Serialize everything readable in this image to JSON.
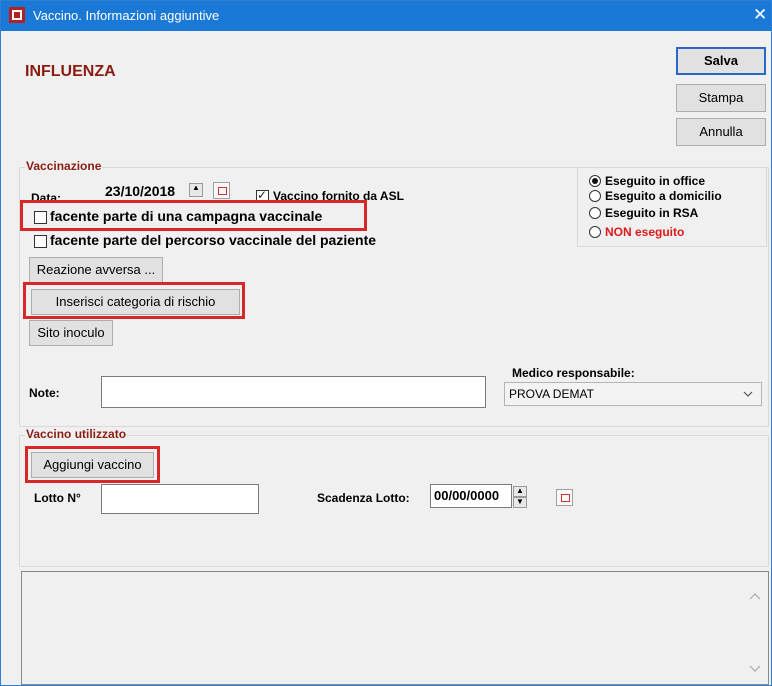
{
  "window": {
    "title": "Vaccino. Informazioni aggiuntive",
    "close_symbol": "✕"
  },
  "header": {
    "title": "INFLUENZA"
  },
  "buttons": {
    "save": "Salva",
    "print": "Stampa",
    "cancel": "Annulla"
  },
  "vaccination": {
    "group_label": "Vaccinazione",
    "date_label": "Data:",
    "date_value": "23/10/2018",
    "asl_checkbox_label": "Vaccino fornito da ASL",
    "asl_checked": true,
    "campaign_checkbox_label": "facente parte di una campagna vaccinale",
    "path_checkbox_label": "facente parte del percorso vaccinale del paziente",
    "adverse_reaction_button": "Reazione avversa ...",
    "risk_category_button": "Inserisci categoria di rischio",
    "injection_site_button": "Sito inoculo",
    "location_options": [
      {
        "label": "Eseguito in office",
        "selected": true
      },
      {
        "label": "Eseguito a domicilio",
        "selected": false
      },
      {
        "label": "Eseguito in RSA",
        "selected": false
      },
      {
        "label": "NON eseguito",
        "selected": false,
        "color": "#e01818"
      }
    ],
    "notes_label": "Note:",
    "notes_value": "",
    "doctor_label": "Medico responsabile:",
    "doctor_value": "PROVA DEMAT"
  },
  "vaccine_used": {
    "group_label": "Vaccino utilizzato",
    "add_vaccine_button": "Aggiungi vaccino",
    "lot_label": "Lotto N°",
    "lot_value": "",
    "expiry_label": "Scadenza Lotto:",
    "expiry_value": "00/00/0000"
  },
  "colors": {
    "accent": "#1a78d6",
    "heading": "#8b1c12",
    "highlight": "#d62828",
    "warning": "#e01818"
  },
  "icons": [
    "app-icon",
    "close-icon",
    "calendar-icon",
    "spin-up-icon",
    "spin-down-icon",
    "chevron-down-icon",
    "scroll-up-icon",
    "scroll-down-icon"
  ]
}
